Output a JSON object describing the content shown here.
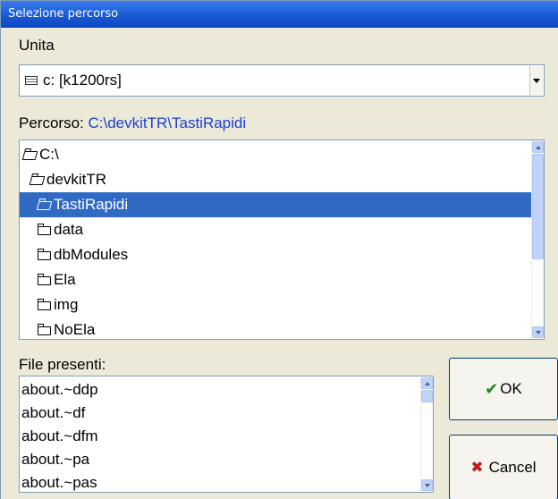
{
  "window": {
    "title": "Selezione percorso"
  },
  "drive": {
    "label": "Unita",
    "value": "c: [k1200rs]",
    "icon": "drive-icon"
  },
  "path": {
    "label": "Percorso:",
    "value": "C:\\devkitTR\\TastiRapidi",
    "value_color": "#1a3fd0"
  },
  "folders": [
    {
      "label": "C:\\",
      "icon": "open-folder-icon"
    },
    {
      "label": "devkitTR",
      "icon": "open-folder-icon"
    },
    {
      "label": "TastiRapidi",
      "icon": "open-folder-icon",
      "selected": true
    },
    {
      "label": "data",
      "icon": "folder-icon"
    },
    {
      "label": "dbModules",
      "icon": "folder-icon"
    },
    {
      "label": "Ela",
      "icon": "folder-icon"
    },
    {
      "label": "img",
      "icon": "folder-icon"
    },
    {
      "label": "NoEla",
      "icon": "folder-icon"
    }
  ],
  "files": {
    "label": "File presenti:",
    "items": [
      "about.~ddp",
      "about.~df",
      "about.~dfm",
      "about.~pa",
      "about.~pas"
    ]
  },
  "buttons": {
    "ok_label": "OK",
    "cancel_label": "Cancel"
  },
  "colors": {
    "titlebar": "#0b46c2",
    "selection": "#316ac5",
    "ok_icon": "#1a8a1a",
    "cancel_icon": "#c01a1a"
  }
}
